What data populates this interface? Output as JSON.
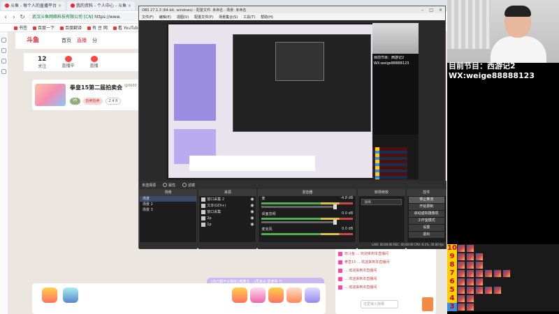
{
  "browser": {
    "tabs": [
      {
        "label": "斗鱼 - 每个人的直播平台"
      },
      {
        "label": "我的资料 - 个人中心 - 斗鱼"
      }
    ],
    "address": {
      "site": "武汉斗鱼网络科技有限公司 [CN]",
      "url": "https://www."
    },
    "bookmarks": [
      "书签",
      "百度一下",
      "百度翻译",
      "有 豆 网",
      "看 YouTube"
    ],
    "site": {
      "logo": "斗鱼",
      "nav": [
        "首页",
        "直播",
        "分"
      ],
      "stats": [
        {
          "value": "12",
          "label": "关注"
        },
        {
          "value": "",
          "label": "直播中"
        },
        {
          "value": "",
          "label": "直播"
        }
      ],
      "card": {
        "title": "拳皇15第二届拍卖会",
        "meta": "@0000",
        "tags": [
          "V6",
          "拍卖拍卖",
          "2 4 8"
        ]
      },
      "chat_bubble": "[自己都不太相信] 鹏鹏主 ...(再来点 爱老师 *)",
      "chat_rows": [
        "玩斗鱼 ... 欢迎来到本直播间",
        "拳皇15 ... 欢迎来到本直播间",
        "... 欢迎来到本直播间",
        "... 欢迎来到本直播间",
        "... 欢迎来到本直播间"
      ],
      "chat_input": "这里输入弹幕"
    }
  },
  "obs": {
    "title": "OBS 27.1.3 (64-bit, windows) - 配置文件: 未命名 - 场景: 未命名",
    "menu": [
      "文件(F)",
      "编辑(E)",
      "视图(V)",
      "配置文件(P)",
      "场景集合(S)",
      "工具(T)",
      "帮助(H)"
    ],
    "scene_label": "未选择源",
    "props_btn": "属性",
    "filters_btn": "滤镜",
    "scenes": {
      "header": "场景",
      "items": [
        "场景",
        "场景 2",
        "场景 3"
      ]
    },
    "sources": {
      "header": "来源",
      "items": [
        "窗口采集 2",
        "文本(GDI+)",
        "窗口采集",
        "2p",
        "1p"
      ]
    },
    "mixer": {
      "header": "混音器",
      "channels": [
        {
          "name": "麦",
          "db": "-4.8 dB"
        },
        {
          "name": "桌面音频",
          "db": "0.0 dB"
        },
        {
          "name": "麦克风",
          "db": "0.0 dB"
        }
      ]
    },
    "transitions": {
      "header": "转场特效",
      "selected": "淡出"
    },
    "controls": {
      "header": "控件",
      "buttons": [
        "停止推流",
        "开始录制",
        "启动虚拟摄像机",
        "工作室模式",
        "设置",
        "退出"
      ]
    },
    "status": "LIVE: 00:00:00   REC: 00:00:00   CPU: 6.1%, 30.00 fps"
  },
  "stream_overlay": {
    "line1": "目前节目：西游记2",
    "line2": "WX:weige88888123"
  },
  "ranking": {
    "numbers": [
      "10",
      "9",
      "8",
      "7",
      "6",
      "5",
      "4",
      "3"
    ]
  }
}
